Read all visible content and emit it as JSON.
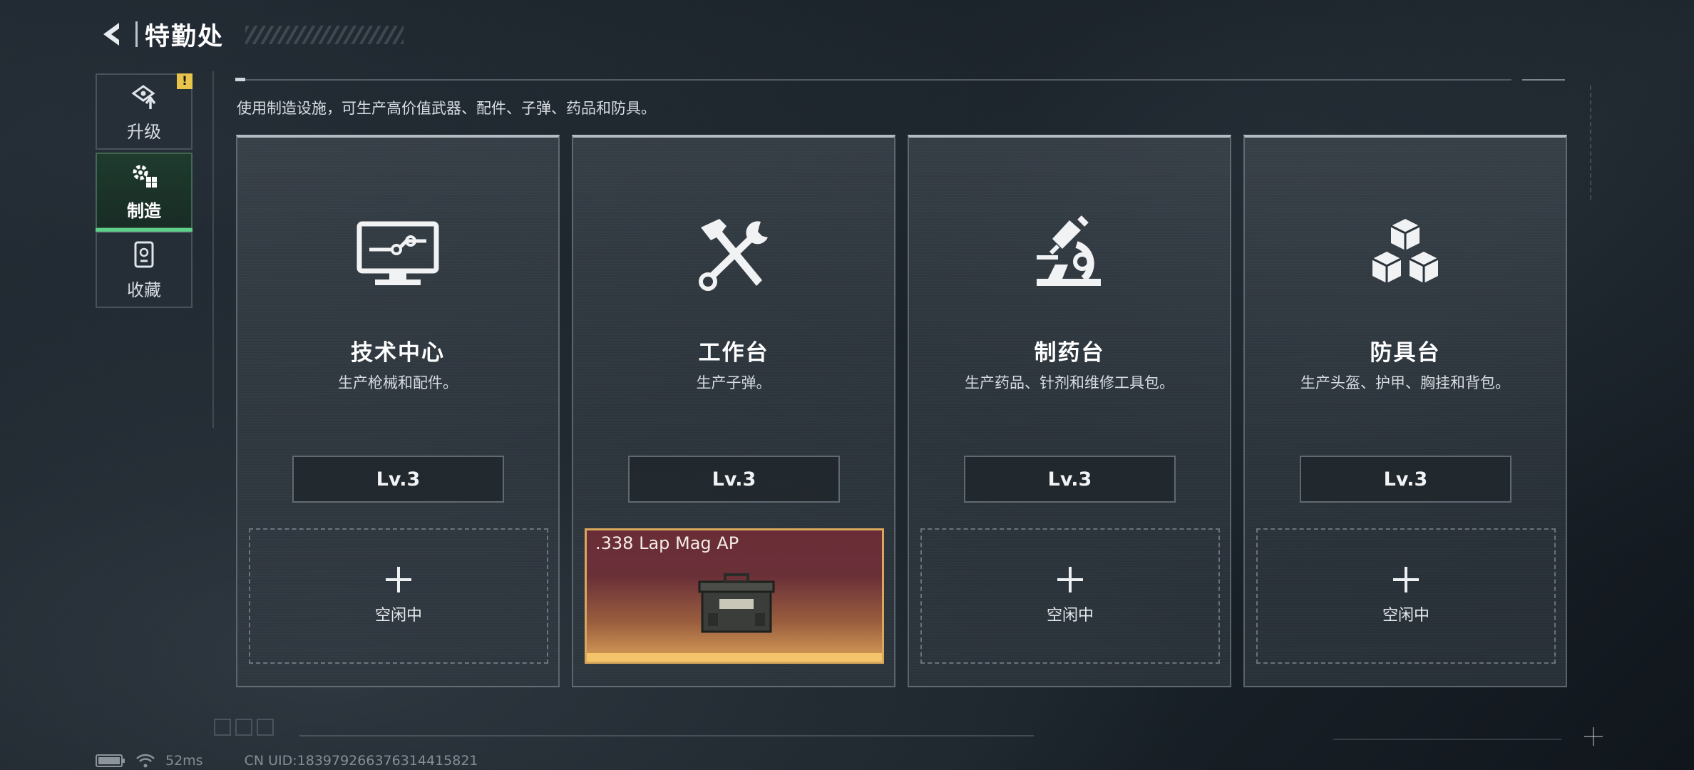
{
  "header": {
    "title": "特勤处",
    "back_icon": "back-arrow-icon"
  },
  "sidebar": {
    "items": [
      {
        "label": "升级",
        "icon": "upgrade-icon",
        "alert": "!",
        "active": false
      },
      {
        "label": "制造",
        "icon": "gear-cube-icon",
        "active": true
      },
      {
        "label": "收藏",
        "icon": "collection-icon",
        "active": false
      }
    ]
  },
  "description": "使用制造设施，可生产高价值武器、配件、子弹、药品和防具。",
  "cards": [
    {
      "title": "技术中心",
      "desc": "生产枪械和配件。",
      "level": "Lv.3",
      "icon": "monitor-circuit-icon",
      "slot": {
        "state": "idle",
        "label": "空闲中"
      }
    },
    {
      "title": "工作台",
      "desc": "生产子弹。",
      "level": "Lv.3",
      "icon": "hammer-wrench-icon",
      "slot": {
        "state": "producing",
        "item": ".338 Lap Mag AP",
        "item_icon": "ammo-box-icon"
      }
    },
    {
      "title": "制药台",
      "desc": "生产药品、针剂和维修工具包。",
      "level": "Lv.3",
      "icon": "microscope-icon",
      "slot": {
        "state": "idle",
        "label": "空闲中"
      }
    },
    {
      "title": "防具台",
      "desc": "生产头盔、护甲、胸挂和背包。",
      "level": "Lv.3",
      "icon": "cubes-icon",
      "slot": {
        "state": "idle",
        "label": "空闲中"
      }
    }
  ],
  "status": {
    "ping": "52ms",
    "uid": "CN UID:1839792663763144158​21",
    "battery_icon": "battery-icon",
    "wifi_icon": "wifi-icon"
  },
  "colors": {
    "accent_green": "#5fd08a",
    "alert_yellow": "#e8c44a",
    "producing_gold": "#d9a85c"
  }
}
